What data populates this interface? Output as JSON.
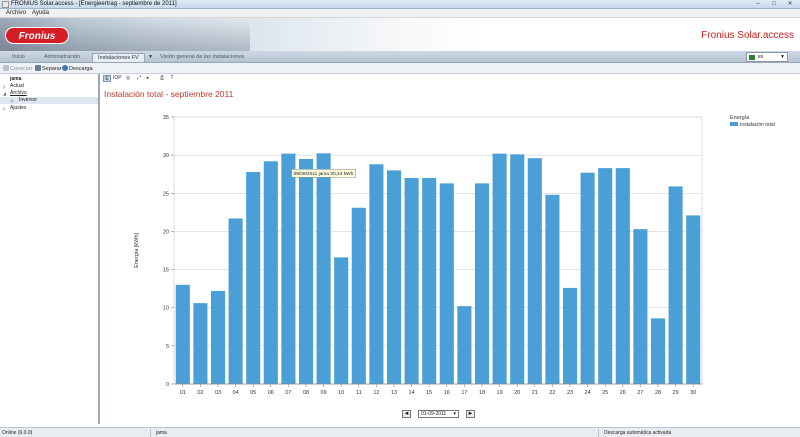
{
  "window": {
    "title": "FRONIUS Solar.access - [Energieertrag - septiembre de 2011]"
  },
  "menu": {
    "items": [
      "Archivo",
      "Ayuda"
    ]
  },
  "banner": {
    "logo_text": "Fronius",
    "brand": "Fronius Solar.access"
  },
  "nav": {
    "tabs": [
      "Inicio",
      "Administración",
      "Instalaciones FV",
      "Visión general de las instalaciones"
    ],
    "active_tab": "Instalaciones FV",
    "language": "es"
  },
  "toolbar": {
    "connect": "Conectar",
    "separate": "Separar",
    "download": "Descarga"
  },
  "sidebar": {
    "items": [
      {
        "label": "jama",
        "level": 0,
        "bold": true
      },
      {
        "label": "Actual",
        "level": 0,
        "arrow": "▷"
      },
      {
        "label": "Archivo",
        "level": 0,
        "arrow": "◢",
        "underline": true
      },
      {
        "label": "Inversor",
        "level": 1,
        "arrow": "▷",
        "selected": true
      },
      {
        "label": "Ajustes",
        "level": 0,
        "arrow": "▷"
      }
    ]
  },
  "chart_tools": [
    "E",
    "IOP",
    "◎",
    "⤢",
    "▸",
    "⎙",
    "T"
  ],
  "chart_data": {
    "type": "bar",
    "title": "Instalación total - septiembre 2011",
    "ylabel": "Energía [kWh]",
    "xlabel": "",
    "ylim": [
      0,
      35
    ],
    "yticks": [
      0,
      5,
      10,
      15,
      20,
      25,
      30,
      35
    ],
    "grid": true,
    "legend_position": "top-right",
    "legend_title": "Energía",
    "color": "#4a9fd6",
    "categories": [
      "01",
      "02",
      "03",
      "04",
      "05",
      "06",
      "07",
      "08",
      "09",
      "10",
      "11",
      "12",
      "13",
      "14",
      "15",
      "16",
      "17",
      "18",
      "19",
      "20",
      "21",
      "22",
      "23",
      "24",
      "25",
      "26",
      "27",
      "28",
      "29",
      "30"
    ],
    "series": [
      {
        "name": "Instalación total",
        "values": [
          13.0,
          10.6,
          12.2,
          21.7,
          27.8,
          29.2,
          30.2,
          29.5,
          30.24,
          16.6,
          23.1,
          28.8,
          28.0,
          27.0,
          27.0,
          26.3,
          10.2,
          26.3,
          30.2,
          30.1,
          29.6,
          24.8,
          12.6,
          27.7,
          28.3,
          28.3,
          20.3,
          8.6,
          25.9,
          22.1
        ]
      }
    ],
    "tooltip": "09/09/2011 jama 30,24 kWh",
    "tooltip_index": 8
  },
  "date_nav": {
    "date": "01-09-2011",
    "prev": "◄",
    "next": "►"
  },
  "status": {
    "state": "Online (6.0.0)",
    "system": "jama",
    "message": "Descarga automática activada"
  }
}
